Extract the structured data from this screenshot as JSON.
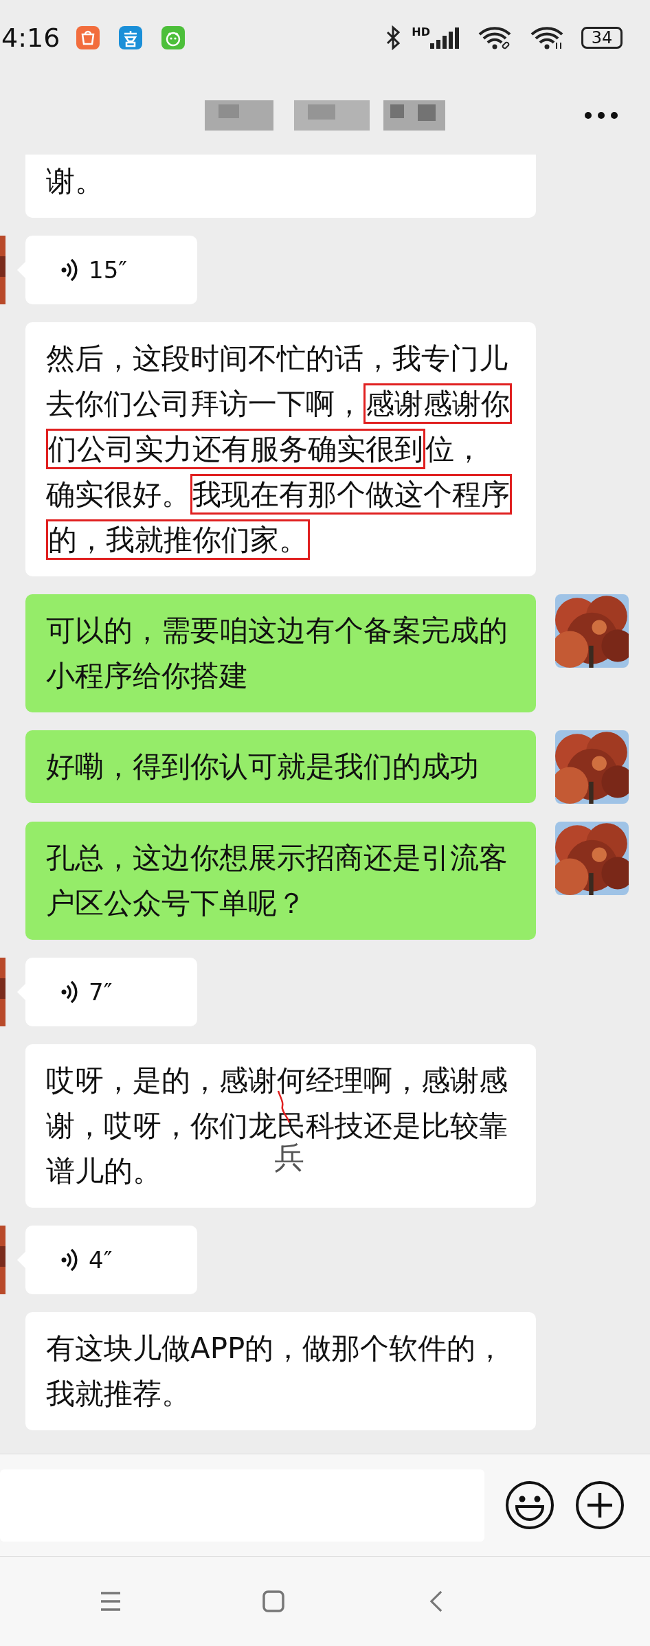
{
  "status_bar": {
    "time": "4:16",
    "network_label": "HD",
    "battery": "34"
  },
  "messages": [
    {
      "kind": "text",
      "outgoing": false,
      "segments": [
        {
          "text": "谢。"
        }
      ]
    },
    {
      "kind": "voice",
      "outgoing": false,
      "duration": "15″"
    },
    {
      "kind": "text",
      "outgoing": false,
      "segments": [
        {
          "text": "然后，这段时间不忙的话，我专门儿去你们公司拜访一下啊，"
        },
        {
          "text": "感谢感谢你们公司实力还有服务确实很到",
          "highlighted": true
        },
        {
          "text": "位，确实很好。"
        },
        {
          "text": "我现在有那个做这个程序的，我就推你们家。",
          "highlighted": true
        }
      ]
    },
    {
      "kind": "text",
      "outgoing": true,
      "segments": [
        {
          "text": "可以的，需要咱这边有个备案完成的小程序给你搭建"
        }
      ]
    },
    {
      "kind": "text",
      "outgoing": true,
      "segments": [
        {
          "text": "好嘞，得到你认可就是我们的成功"
        }
      ]
    },
    {
      "kind": "text",
      "outgoing": true,
      "segments": [
        {
          "text": "孔总，这边你想展示招商还是引流客户区公众号下单呢？"
        }
      ]
    },
    {
      "kind": "voice",
      "outgoing": false,
      "duration": "7″"
    },
    {
      "kind": "text",
      "outgoing": false,
      "segments": [
        {
          "text": "哎呀，是的，感谢何经理啊，感谢感谢，哎呀，你们龙"
        },
        {
          "text": "民",
          "correction": "兵"
        },
        {
          "text": "科技还是比较靠谱儿的。"
        }
      ]
    },
    {
      "kind": "voice",
      "outgoing": false,
      "duration": "4″"
    },
    {
      "kind": "text",
      "outgoing": false,
      "segments": [
        {
          "text": "有这块儿做APP的，做那个软件的，我就推荐。"
        }
      ]
    }
  ]
}
